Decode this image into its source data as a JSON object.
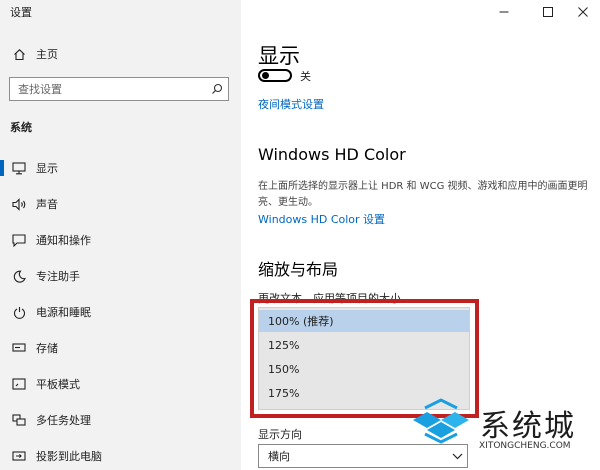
{
  "window": {
    "title": "设置",
    "minimize_icon": "minimize-icon",
    "maximize_icon": "maximize-icon",
    "close_icon": "close-icon"
  },
  "sidebar": {
    "home": {
      "label": "主页",
      "icon": "home-icon"
    },
    "search": {
      "placeholder": "查找设置",
      "icon": "search-icon"
    },
    "section": "系统",
    "items": [
      {
        "label": "显示",
        "icon": "monitor-icon",
        "selected": true
      },
      {
        "label": "声音",
        "icon": "speaker-icon"
      },
      {
        "label": "通知和操作",
        "icon": "notification-icon"
      },
      {
        "label": "专注助手",
        "icon": "moon-icon"
      },
      {
        "label": "电源和睡眠",
        "icon": "power-icon"
      },
      {
        "label": "存储",
        "icon": "storage-icon"
      },
      {
        "label": "平板模式",
        "icon": "tablet-icon"
      },
      {
        "label": "多任务处理",
        "icon": "multitask-icon"
      },
      {
        "label": "投影到此电脑",
        "icon": "project-icon"
      }
    ]
  },
  "main": {
    "title": "显示",
    "night_light": {
      "state": "关",
      "on": false
    },
    "night_light_link": "夜间模式设置",
    "hdr": {
      "heading": "Windows HD Color",
      "description": "在上面所选择的显示器上让 HDR 和 WCG 视频、游戏和应用中的画面更明亮、更生动。",
      "link": "Windows HD Color 设置"
    },
    "scale": {
      "heading": "缩放与布局",
      "label": "更改文本、应用等项目的大小",
      "options": [
        "100% (推荐)",
        "125%",
        "150%",
        "175%"
      ],
      "selected": "100% (推荐)"
    },
    "orientation": {
      "label": "显示方向",
      "value": "横向"
    }
  },
  "watermark": {
    "text": "系统城",
    "url_text": "XITONGCHENG.COM"
  },
  "colors": {
    "accent": "#0067c0",
    "highlight_box": "#c02020",
    "selected_option": "#b9d1ea",
    "sidebar_bg": "#f2f2f2"
  }
}
